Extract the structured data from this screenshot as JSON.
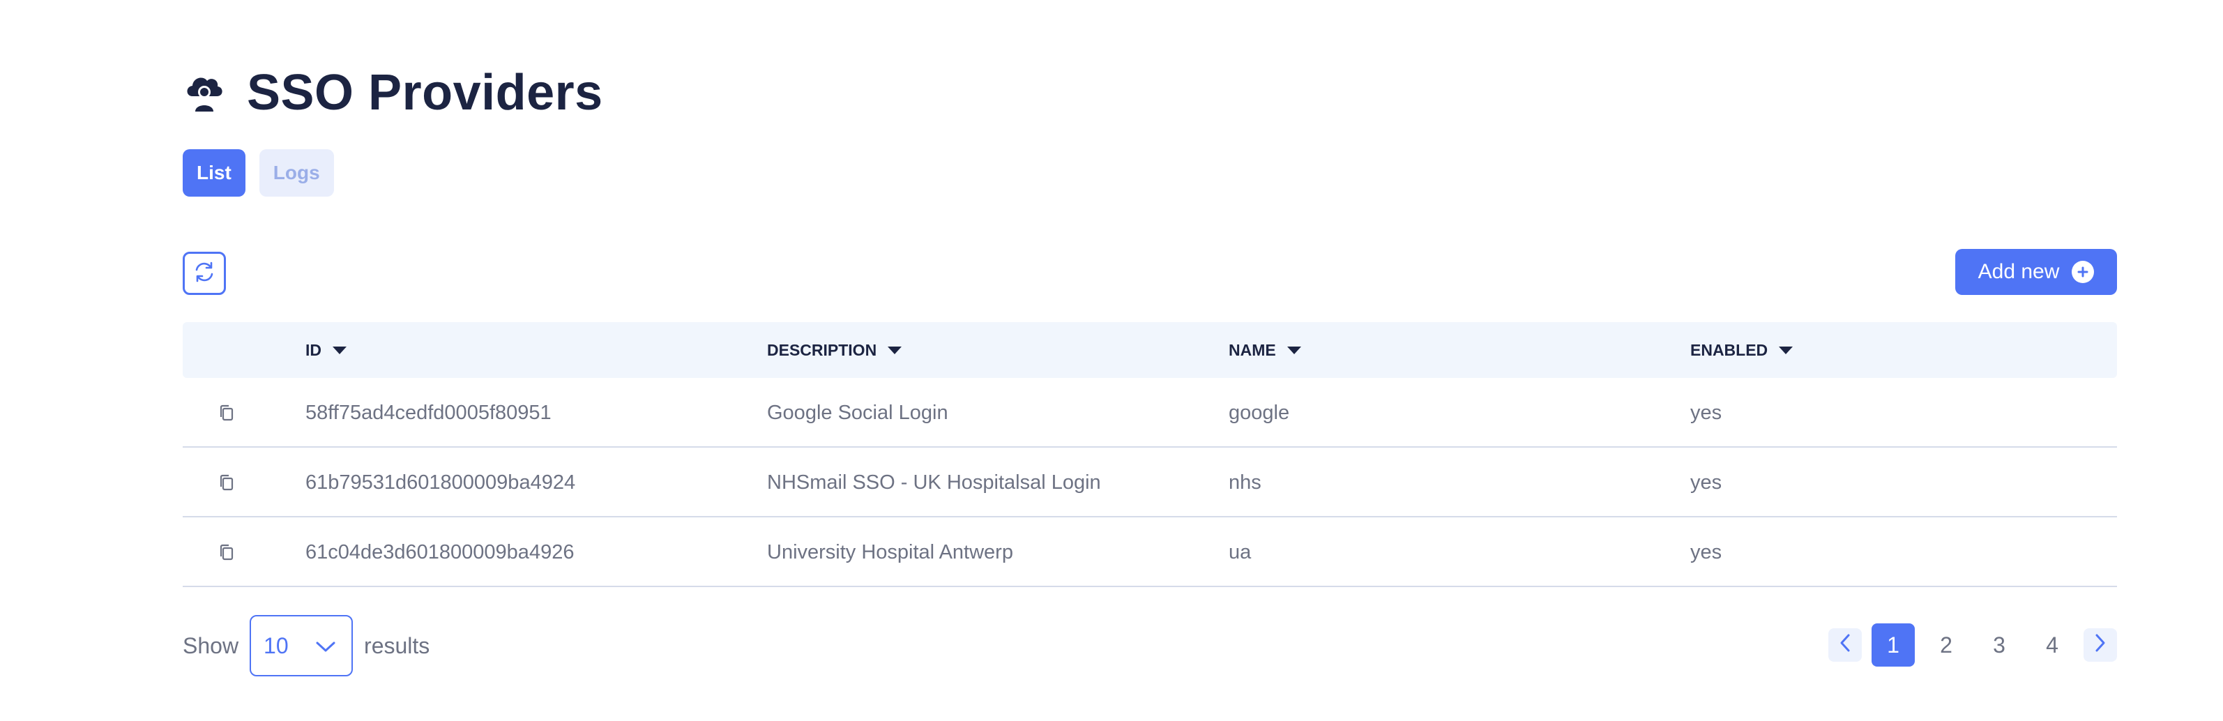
{
  "header": {
    "title": "SSO Providers",
    "icon": "cloud-user-icon"
  },
  "tabs": [
    {
      "label": "List",
      "active": true
    },
    {
      "label": "Logs",
      "active": false
    }
  ],
  "toolbar": {
    "refresh_icon": "refresh-icon",
    "add_label": "Add new",
    "add_icon": "plus-circle-icon"
  },
  "table": {
    "columns": [
      "ID",
      "DESCRIPTION",
      "NAME",
      "ENABLED"
    ],
    "rows": [
      {
        "id": "58ff75ad4cedfd0005f80951",
        "description": "Google Social Login",
        "name": "google",
        "enabled": "yes"
      },
      {
        "id": "61b79531d601800009ba4924",
        "description": "NHSmail SSO - UK Hospitalsal Login",
        "name": "nhs",
        "enabled": "yes"
      },
      {
        "id": "61c04de3d601800009ba4926",
        "description": "University Hospital Antwerp",
        "name": "ua",
        "enabled": "yes"
      }
    ]
  },
  "footer": {
    "show_label": "Show",
    "page_size": "10",
    "results_label": "results",
    "pages": [
      "1",
      "2",
      "3",
      "4"
    ],
    "current_page": "1"
  },
  "colors": {
    "accent": "#4f74f5",
    "header_bg": "#f1f6fd",
    "text_dark": "#1c2442",
    "text_muted": "#6d7283"
  }
}
